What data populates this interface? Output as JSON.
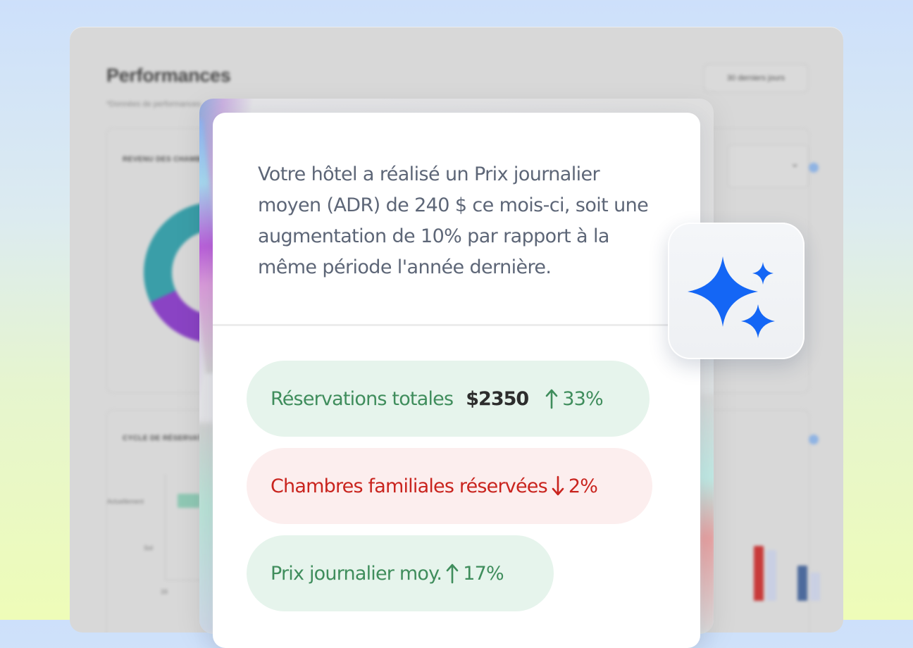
{
  "dashboard": {
    "title": "Performances",
    "subtitle": "*Données de performances",
    "date_range": "30 derniers jours",
    "revenue_panel_title": "REVENU DES CHAMBRES",
    "cycle_panel_title": "CYCLE DE RÉSERVATION",
    "cycle_labels": [
      "Actuellement",
      "Sol",
      "16"
    ]
  },
  "insight": {
    "summary": "Votre hôtel a réalisé un Prix journalier moyen (ADR) de 240 $ ce mois-ci, soit une augmentation de 10% par rapport à la même période l'année dernière.",
    "metrics": [
      {
        "label": "Réservations totales",
        "value": "$2350",
        "delta": "33%",
        "direction": "up",
        "tone": "positive"
      },
      {
        "label": "Chambres familiales réservées",
        "value": "",
        "delta": "2%",
        "direction": "down",
        "tone": "negative"
      },
      {
        "label": "Prix journalier moy.",
        "value": "",
        "delta": "17%",
        "direction": "up",
        "tone": "positive"
      }
    ]
  },
  "badge": {
    "icon": "sparkles-icon",
    "color": "#1466f5"
  },
  "colors": {
    "positive": "#3f8d5c",
    "negative": "#c9241e",
    "accent": "#1466f5"
  }
}
